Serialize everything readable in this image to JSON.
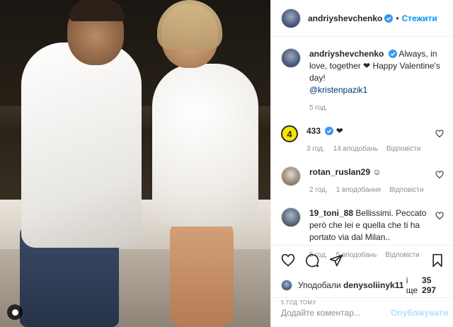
{
  "post": {
    "author": "andriyshevchenko",
    "follow_label": "Стежити",
    "caption_text": "Always, in love, together ❤ Happy Valentine's day!",
    "caption_mention": "@kristenpazik1",
    "caption_time": "5 год."
  },
  "comments": [
    {
      "user": "433",
      "text": "❤",
      "time": "3 год.",
      "likes": "14 вподобань",
      "reply": "Відповісти",
      "verified": true
    },
    {
      "user": "rotan_ruslan29",
      "text": "☺",
      "time": "2 год.",
      "likes": "1 вподобання",
      "reply": "Відповісти",
      "verified": false
    },
    {
      "user": "19_toni_88",
      "text": "Bellissimi. Peccato però che lei e quella che ti ha portato via dal Milan..",
      "time": "5 год.",
      "likes": "5 вподобань",
      "reply": "Відповісти",
      "verified": false
    }
  ],
  "likes_bar": {
    "prefix": "Уподобали",
    "user": "denysoliinyk11",
    "suffix": "і ще",
    "count": "35 297"
  },
  "time_ago": "5 ГОД ТОМУ",
  "add_comment": {
    "placeholder": "Додайте коментар...",
    "publish_label": "Опублікувати"
  },
  "colors": {
    "accent": "#0095f6",
    "publish_disabled": "#b2dffc",
    "muted": "#8e8e8e",
    "badge_433": "#f5e400"
  }
}
